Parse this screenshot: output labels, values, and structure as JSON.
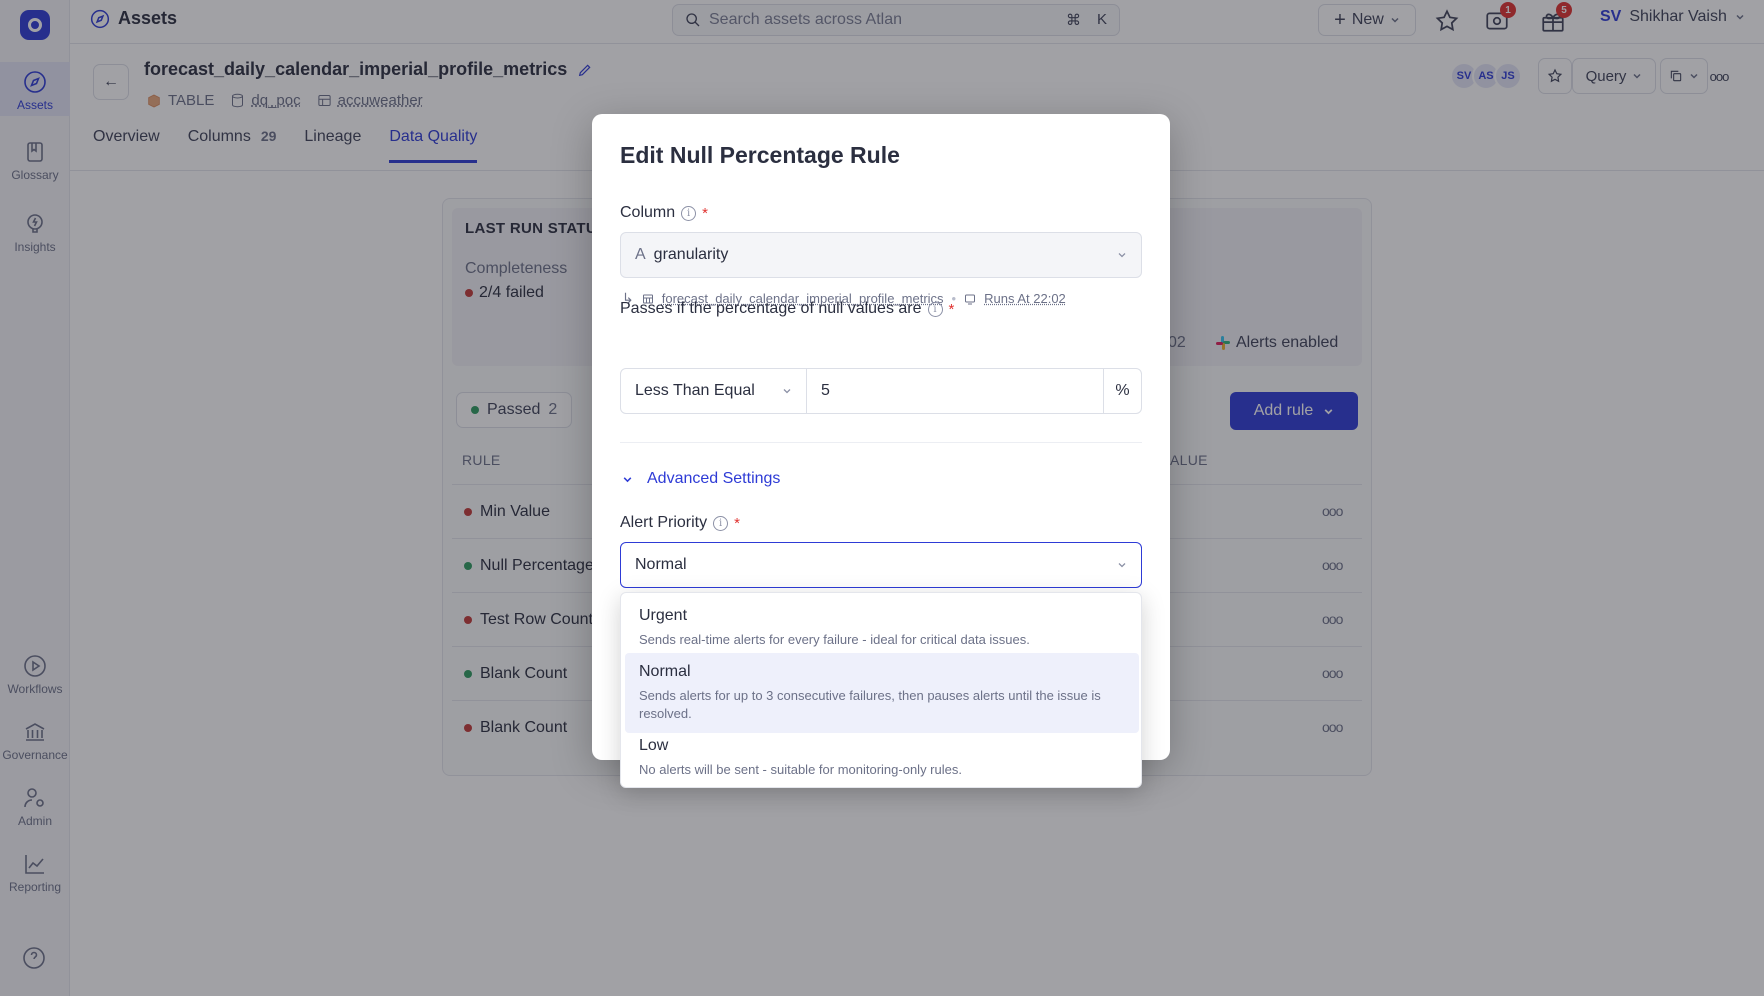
{
  "sidebar": {
    "items": [
      {
        "label": "Assets",
        "icon": "compass-icon"
      },
      {
        "label": "Glossary",
        "icon": "book-icon"
      },
      {
        "label": "Insights",
        "icon": "bulb-icon"
      },
      {
        "label": "Workflows",
        "icon": "play-icon"
      },
      {
        "label": "Governance",
        "icon": "bank-icon"
      },
      {
        "label": "Admin",
        "icon": "user-gear-icon"
      },
      {
        "label": "Reporting",
        "icon": "chart-icon"
      }
    ]
  },
  "topbar": {
    "section": "Assets",
    "search_placeholder": "Search assets across Atlan",
    "shortcut_key1": "⌘",
    "shortcut_key2": "K",
    "new_label": "New",
    "notif_badge": "1",
    "gift_badge": "5",
    "user_initials": "SV",
    "user_name": "Shikhar Vaish"
  },
  "asset": {
    "title": "forecast_daily_calendar_imperial_profile_metrics",
    "type": "TABLE",
    "schema": "dq_poc",
    "database": "accuweather",
    "avatars": [
      "SV",
      "AS",
      "JS"
    ],
    "query_label": "Query"
  },
  "tabs": [
    {
      "label": "Overview"
    },
    {
      "label": "Columns",
      "count": "29"
    },
    {
      "label": "Lineage"
    },
    {
      "label": "Data Quality"
    }
  ],
  "background": {
    "run_status_title": "LAST RUN STATU",
    "completeness_label": "Completeness",
    "completeness_value": "2/4 failed",
    "truncated_value": "02",
    "alerts_label": "Alerts enabled",
    "filter_passed": "Passed",
    "filter_passed_count": "2",
    "add_rule_label": "Add rule",
    "col_rule": "RULE",
    "col_value": "ALUE",
    "rules": [
      {
        "name": "Min Value",
        "status": "failed"
      },
      {
        "name": "Null Percentage",
        "status": "passed"
      },
      {
        "name": "Test Row Count",
        "status": "failed"
      },
      {
        "name": "Blank Count",
        "status": "passed"
      },
      {
        "name": "Blank Count",
        "status": "failed"
      }
    ],
    "more_label": "ooo"
  },
  "modal": {
    "title": "Edit Null Percentage Rule",
    "column_label": "Column",
    "column_value": "granularity",
    "column_type_glyph": "A",
    "table_ref": "forecast_daily_calendar_imperial_profile_metrics",
    "runs_at": "Runs At 22:02",
    "condition_label": "Passes if the percentage of null values are",
    "operator": "Less Than Equal",
    "threshold": "5",
    "unit": "%",
    "advanced_label": "Advanced Settings",
    "priority_label": "Alert Priority",
    "priority_value": "Normal",
    "required_mark": "*"
  },
  "priority_options": [
    {
      "title": "Urgent",
      "desc": "Sends real-time alerts for every failure - ideal for critical data issues."
    },
    {
      "title": "Normal",
      "desc": "Sends alerts for up to 3 consecutive failures, then pauses alerts until the issue is resolved."
    },
    {
      "title": "Low",
      "desc": "No alerts will be sent - suitable for monitoring-only rules."
    }
  ],
  "colors": {
    "accent": "#2e3bd6",
    "failed": "#c23a37",
    "passed": "#2e9b5f"
  }
}
